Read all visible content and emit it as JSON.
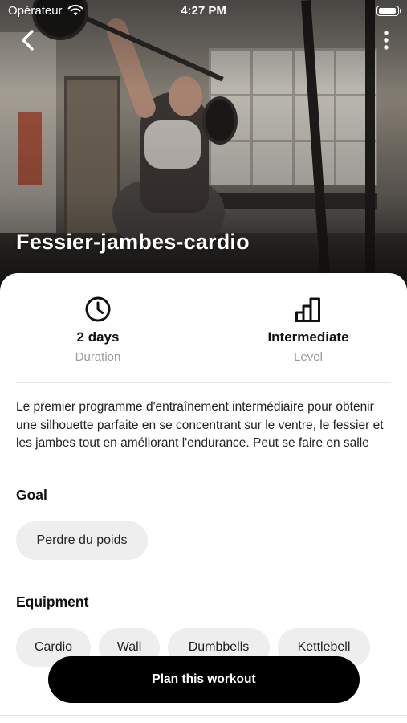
{
  "status_bar": {
    "carrier": "Opérateur",
    "time": "4:27 PM"
  },
  "hero": {
    "title": "Fessier-jambes-cardio",
    "back_icon": "chevron-left-icon",
    "more_icon": "vertical-ellipsis-icon"
  },
  "stats": {
    "duration": {
      "value": "2 days",
      "label": "Duration",
      "icon": "clock-icon"
    },
    "level": {
      "value": "Intermediate",
      "label": "Level",
      "icon": "bar-chart-icon"
    }
  },
  "description": "Le premier programme d'entraînement intermédiaire pour obtenir une silhouette parfaite en se concentrant sur le ventre, le fessier et les jambes tout en améliorant l'endurance. Peut se faire en salle",
  "goal": {
    "heading": "Goal",
    "items": [
      "Perdre du poids"
    ]
  },
  "equipment": {
    "heading": "Equipment",
    "items": [
      "Cardio",
      "Wall",
      "Dumbbells",
      "Kettlebell"
    ]
  },
  "cta": {
    "label": "Plan this workout"
  },
  "colors": {
    "accent": "#000000",
    "chip_bg": "#eeeeee",
    "muted_text": "#9b9b9b"
  }
}
